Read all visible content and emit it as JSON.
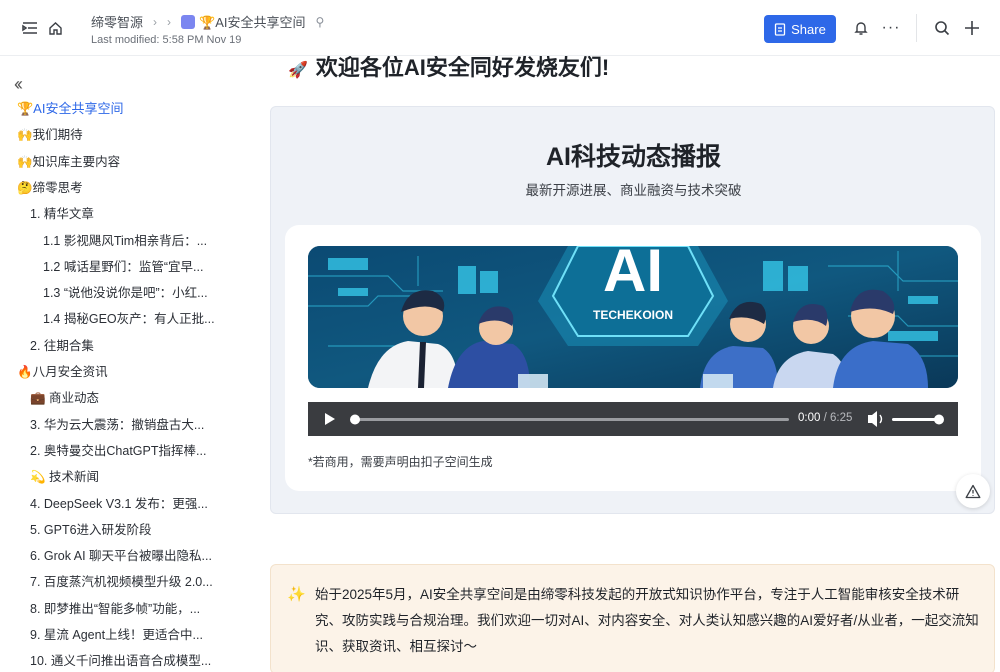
{
  "header": {
    "breadcrumb_root": "缔零智源",
    "breadcrumb_current": "🏆AI安全共享空间",
    "last_modified": "Last modified: 5:58 PM Nov 19",
    "share_label": "Share"
  },
  "sidebar": {
    "items": [
      {
        "label": "🏆AI安全共享空间",
        "level": 0
      },
      {
        "label": "🙌我们期待",
        "level": 0
      },
      {
        "label": "🙌知识库主要内容",
        "level": 0
      },
      {
        "label": "🤔缔零思考",
        "level": 0
      },
      {
        "label": "1. 精华文章",
        "level": 1
      },
      {
        "label": "1.1 影视飓风Tim相亲背后：...",
        "level": 2
      },
      {
        "label": "1.2 喊话星野们：监管“宜早...",
        "level": 2
      },
      {
        "label": "1.3 “说他没说你是吧”：小红...",
        "level": 2
      },
      {
        "label": "1.4 揭秘GEO灰产：有人正批...",
        "level": 2
      },
      {
        "label": "2. 往期合集",
        "level": 1
      },
      {
        "label": "🔥八月安全资讯",
        "level": 0
      },
      {
        "label": "💼 商业动态",
        "level": 1
      },
      {
        "label": "3. 华为云大震荡：撤销盘古大...",
        "level": 1
      },
      {
        "label": "2. 奥特曼交出ChatGPT指挥棒...",
        "level": 1
      },
      {
        "label": "💫 技术新闻",
        "level": 1
      },
      {
        "label": "4. DeepSeek V3.1 发布：更强...",
        "level": 1
      },
      {
        "label": "5. GPT6进入研发阶段",
        "level": 1
      },
      {
        "label": "6. Grok AI 聊天平台被曝出隐私...",
        "level": 1
      },
      {
        "label": "7. 百度蒸汽机视频模型升级 2.0...",
        "level": 1
      },
      {
        "label": "8. 即梦推出“智能多帧”功能，...",
        "level": 1
      },
      {
        "label": "9. 星流 Agent上线！更适合中...",
        "level": 1
      },
      {
        "label": "10. 通义千问推出语音合成模型...",
        "level": 1
      }
    ]
  },
  "main": {
    "heading": "欢迎各位AI安全同好发烧友们!",
    "card_title": "AI科技动态播报",
    "card_subtitle": "最新开源进展、商业融资与技术突破",
    "banner_big_text": "AI",
    "banner_brand": "TECHEKOION",
    "player_time_current": "0:00",
    "player_time_total": "/ 6:25",
    "playback_progress": 0,
    "note": "*若商用，需要声明由扣子空间生成",
    "callout_text": "始于2025年5月，AI安全共享空间是由缔零科技发起的开放式知识协作平台，专注于人工智能审核安全技术研究、攻防实践与合规治理。我们欢迎一切对AI、对内容安全、对人类认知感兴趣的AI爱好者/从业者，一起交流知识、获取资讯、相互探讨～"
  },
  "colors": {
    "accent": "#2e68e8",
    "banner_bg": "#0e3f63",
    "callout_bg": "#fcf3e8"
  }
}
